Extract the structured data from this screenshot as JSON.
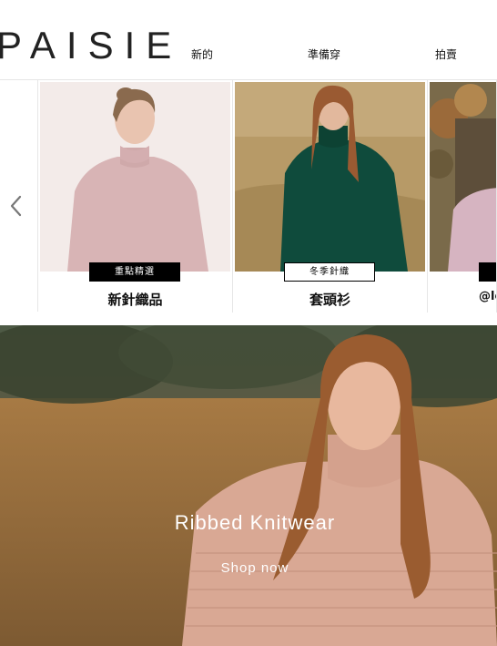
{
  "brand": {
    "logo_text": "PAISIE"
  },
  "nav": {
    "items": [
      {
        "label": "新的"
      },
      {
        "label": "準備穿"
      },
      {
        "label": "拍賣"
      }
    ]
  },
  "carousel": {
    "prev_icon": "chevron-left-icon",
    "cards": [
      {
        "badge": "重點精選",
        "title": "新針織品",
        "badge_style": "dark"
      },
      {
        "badge": "冬季針織",
        "title": "套頭衫",
        "badge_style": "light"
      },
      {
        "badge": "",
        "title": "@le",
        "badge_style": "dark"
      }
    ]
  },
  "hero": {
    "title": "Ribbed Knitwear",
    "link": "Shop now"
  },
  "colors": {
    "text": "#111111",
    "divider": "#e6e6e6",
    "badge_dark": "#000000",
    "hero_text": "#ffffff"
  }
}
